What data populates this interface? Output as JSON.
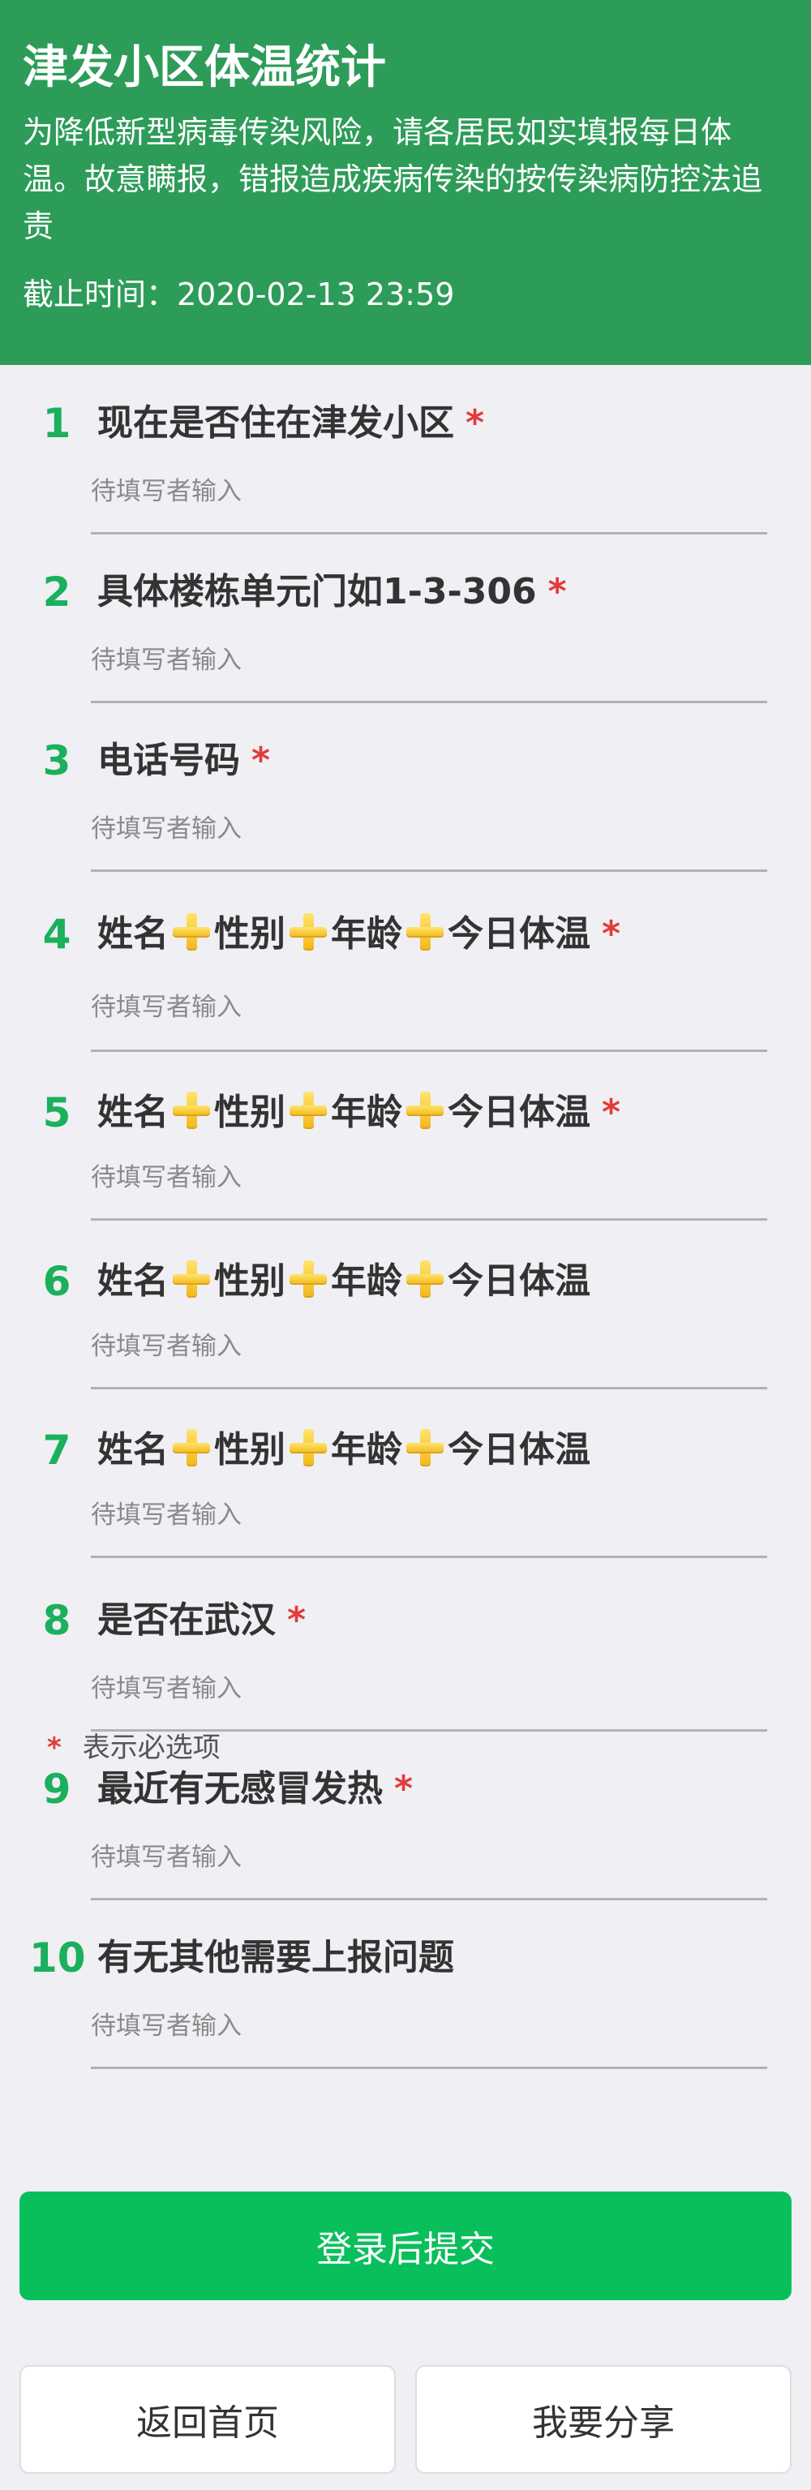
{
  "header": {
    "title": "津发小区体温统计",
    "description": "为降低新型病毒传染风险，请各居民如实填报每日体温。故意瞒报，错报造成疾病传染的按传染病防控法追责",
    "deadline": "截止时间：2020-02-13 23:59"
  },
  "questions": [
    {
      "num": "1",
      "label": "现在是否住在津发小区",
      "required": "*",
      "placeholder": "待填写者输入"
    },
    {
      "num": "2",
      "label": "具体楼栋单元门如1-3-306",
      "required": "*",
      "placeholder": "待填写者输入"
    },
    {
      "num": "3",
      "label": "电话号码",
      "required": "*",
      "placeholder": "待填写者输入"
    },
    {
      "num": "4",
      "parts": [
        "姓名",
        "性别",
        "年龄",
        "今日体温"
      ],
      "required": "*",
      "placeholder": "待填写者输入"
    },
    {
      "num": "5",
      "parts": [
        "姓名",
        "性别",
        "年龄",
        "今日体温"
      ],
      "required": "*",
      "placeholder": "待填写者输入"
    },
    {
      "num": "6",
      "parts": [
        "姓名",
        "性别",
        "年龄",
        "今日体温"
      ],
      "placeholder": "待填写者输入"
    },
    {
      "num": "7",
      "parts": [
        "姓名",
        "性别",
        "年龄",
        "今日体温"
      ],
      "placeholder": "待填写者输入"
    },
    {
      "num": "8",
      "label": "是否在武汉",
      "required": "*",
      "placeholder": "待填写者输入"
    },
    {
      "num": "9",
      "label": "最近有无感冒发热",
      "required": "*",
      "placeholder": "待填写者输入"
    },
    {
      "num": "10",
      "label": "有无其他需要上报问题",
      "placeholder": "待填写者输入"
    }
  ],
  "legend": {
    "star": "*",
    "text": "表示必选项"
  },
  "buttons": {
    "submit": "登录后提交",
    "home": "返回首页",
    "share": "我要分享"
  },
  "icons": {
    "separator": "plus-icon"
  },
  "colors": {
    "header_bg": "#2e9c59",
    "accent_green": "#1bb05c",
    "submit_bg": "#08bf5c",
    "required_red": "#e23b3b",
    "page_bg": "#efeff4"
  }
}
